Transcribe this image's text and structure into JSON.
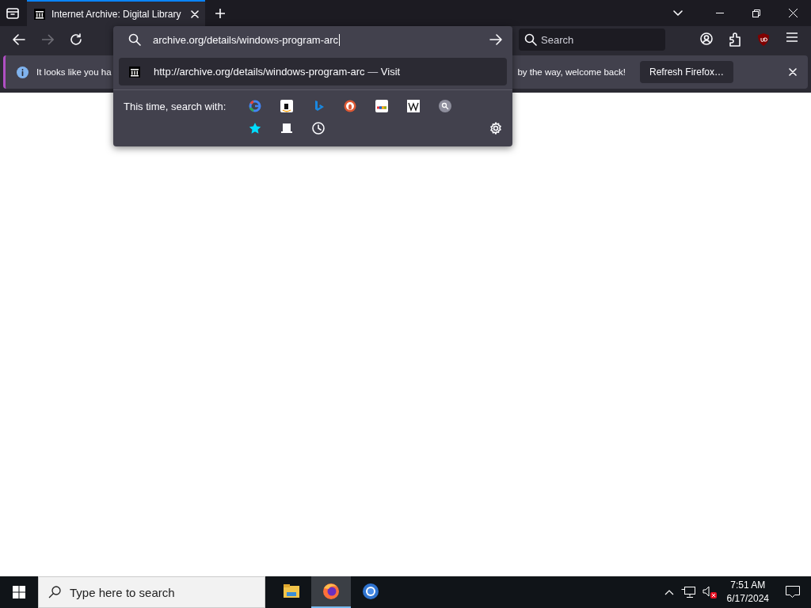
{
  "tab": {
    "title": "Internet Archive: Digital Library",
    "selected": true
  },
  "urlbar": {
    "value": "archive.org/details/windows-program-arc"
  },
  "search_field": {
    "placeholder": "Search"
  },
  "notification": {
    "text_start": "It looks like you ha",
    "text_end": "by the way, welcome back!",
    "button": "Refresh Firefox…"
  },
  "url_suggestion": {
    "url": "http://archive.org/details/windows-program-arc",
    "separator": "—",
    "action": "Visit",
    "selected": true
  },
  "search_with": {
    "label": "This time, search with:"
  },
  "taskbar": {
    "search_placeholder": "Type here to search",
    "time": "7:51 AM",
    "date": "6/17/2024",
    "apps": [
      {
        "kind": "folder",
        "selected": false
      },
      {
        "kind": "fox",
        "selected": true
      },
      {
        "kind": "ring",
        "selected": false
      }
    ]
  }
}
